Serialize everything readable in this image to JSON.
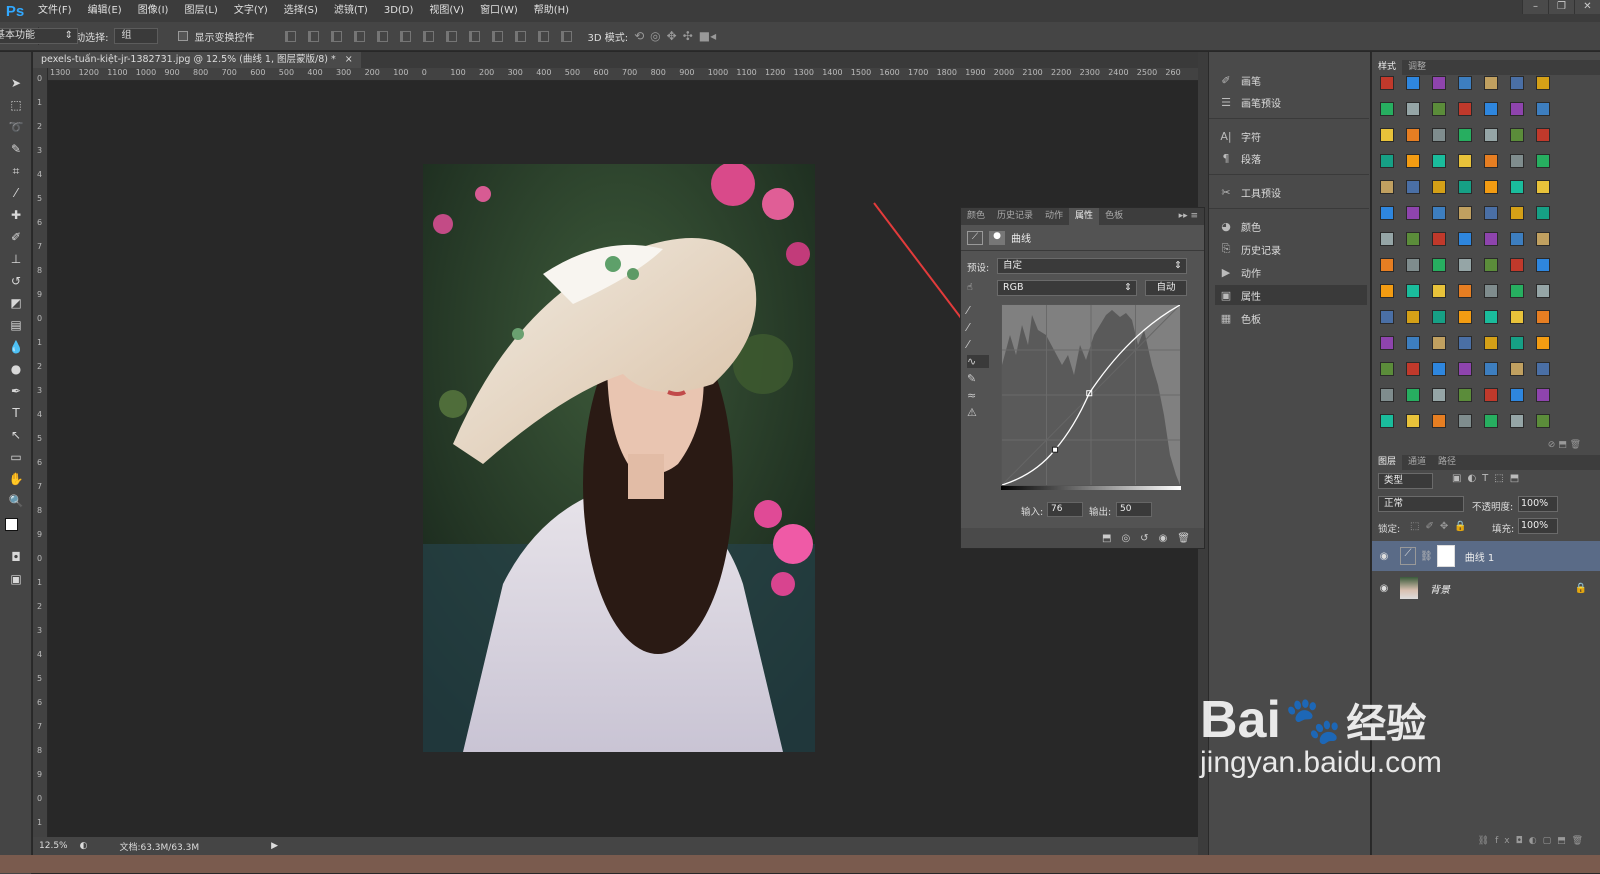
{
  "app": {
    "logo": "Ps"
  },
  "menu": [
    "文件(F)",
    "编辑(E)",
    "图像(I)",
    "图层(L)",
    "文字(Y)",
    "选择(S)",
    "滤镜(T)",
    "3D(D)",
    "视图(V)",
    "窗口(W)",
    "帮助(H)"
  ],
  "window_controls": [
    "–",
    "❐",
    "✕"
  ],
  "options": {
    "auto_select_label": "自动选择:",
    "auto_select_value": "组",
    "show_transform_label": "显示变换控件",
    "mode3d_label": "3D 模式:",
    "workspace": "基本功能"
  },
  "document": {
    "tab_title": "pexels-tuấn-kiệt-jr-1382731.jpg @ 12.5% (曲线 1, 图层蒙版/8) *",
    "close": "×"
  },
  "ruler_h": [
    "1300",
    "1200",
    "1100",
    "1000",
    "900",
    "800",
    "700",
    "600",
    "500",
    "400",
    "300",
    "200",
    "100",
    "0",
    "100",
    "200",
    "300",
    "400",
    "500",
    "600",
    "700",
    "800",
    "900",
    "1000",
    "1100",
    "1200",
    "1300",
    "1400",
    "1500",
    "1600",
    "1700",
    "1800",
    "1900",
    "2000",
    "2100",
    "2200",
    "2300",
    "2400",
    "2500",
    "260"
  ],
  "ruler_v": [
    "0",
    "1",
    "2",
    "3",
    "4",
    "5",
    "6",
    "7",
    "8",
    "9",
    "0",
    "1",
    "2",
    "3",
    "4",
    "5",
    "6",
    "7",
    "8",
    "9",
    "0",
    "1",
    "2",
    "3",
    "4",
    "5",
    "6",
    "7",
    "8",
    "9",
    "0",
    "1"
  ],
  "status": {
    "zoom": "12.5%",
    "doc_size": "文档:63.3M/63.3M"
  },
  "properties": {
    "tabs": [
      "颜色",
      "历史记录",
      "动作",
      "属性",
      "色板"
    ],
    "active_tab": "属性",
    "header": "曲线",
    "preset_label": "预设:",
    "preset_value": "自定",
    "channel_value": "RGB",
    "auto_button": "自动",
    "input_label": "输入:",
    "input_value": "76",
    "output_label": "输出:",
    "output_value": "50",
    "curve": {
      "point1_in": 76,
      "point1_out": 50,
      "point2_in": 125,
      "point2_out": 130
    }
  },
  "mid_panel": {
    "items": [
      {
        "icon": "brush-icon",
        "label": "画笔"
      },
      {
        "icon": "brush-preset-icon",
        "label": "画笔预设"
      },
      {
        "icon": "character-icon",
        "label": "字符"
      },
      {
        "icon": "paragraph-icon",
        "label": "段落"
      },
      {
        "icon": "tool-preset-icon",
        "label": "工具预设"
      },
      {
        "icon": "color-icon",
        "label": "颜色"
      },
      {
        "icon": "history-icon",
        "label": "历史记录"
      },
      {
        "icon": "actions-icon",
        "label": "动作"
      },
      {
        "icon": "properties-icon",
        "label": "属性"
      },
      {
        "icon": "swatches-icon",
        "label": "色板"
      }
    ],
    "active": "属性"
  },
  "styles_panel": {
    "tabs": [
      "样式",
      "调整"
    ]
  },
  "layers_panel": {
    "tabs": [
      "图层",
      "通道",
      "路径"
    ],
    "filter": "类型",
    "blend_mode": "正常",
    "opacity_label": "不透明度:",
    "opacity_value": "100%",
    "lock_label": "锁定:",
    "fill_label": "填充:",
    "fill_value": "100%",
    "layers": [
      {
        "name": "曲线 1",
        "selected": true
      },
      {
        "name": "背景",
        "selected": false
      }
    ]
  },
  "watermark": {
    "brand": "Bai",
    "brand2": "经验",
    "url": "jingyan.baidu.com"
  },
  "colors": {
    "accent": "#31a8ff",
    "arrow": "#e23b3b",
    "panel": "#535353"
  }
}
